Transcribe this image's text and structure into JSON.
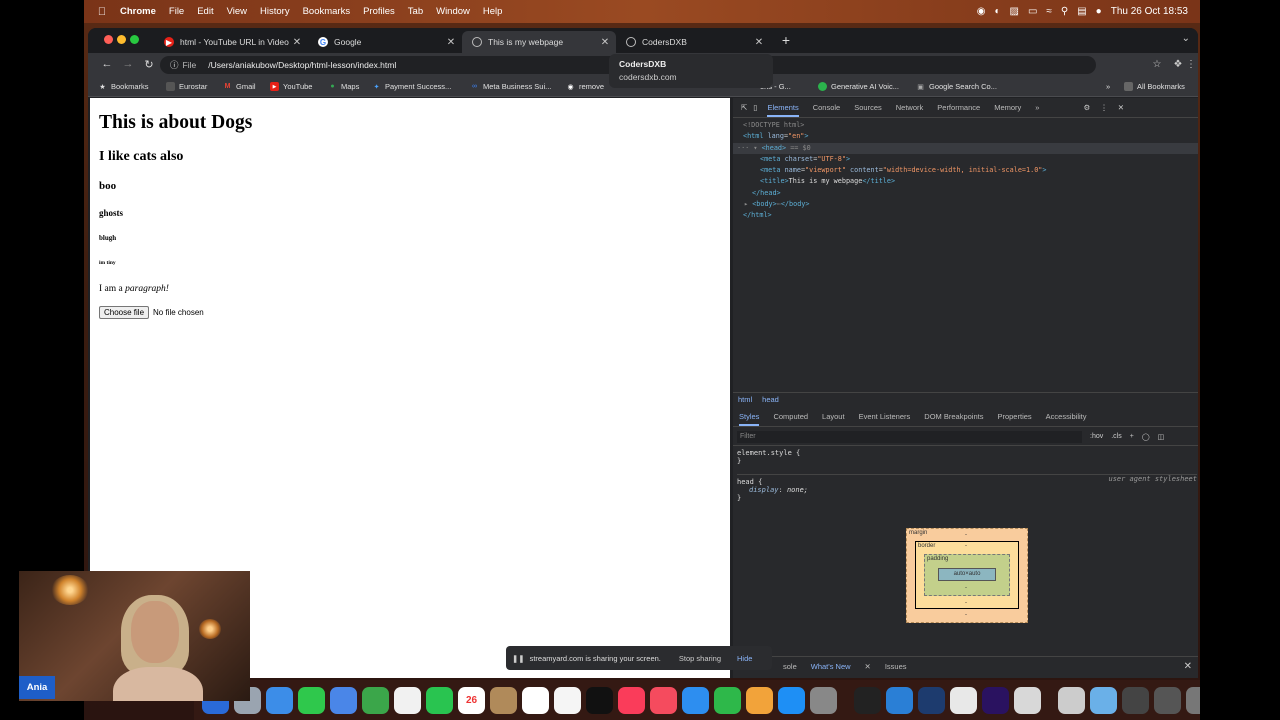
{
  "menubar": {
    "app": "Chrome",
    "items": [
      "File",
      "Edit",
      "View",
      "History",
      "Bookmarks",
      "Profiles",
      "Tab",
      "Window",
      "Help"
    ],
    "datetime": "Thu 26 Oct  18:53"
  },
  "tabs": [
    {
      "label": "html - YouTube URL in Video T",
      "icon": "youtube-icon",
      "active": false
    },
    {
      "label": "Google",
      "icon": "google-icon",
      "active": false
    },
    {
      "label": "This is my webpage",
      "icon": "globe-icon",
      "active": true
    },
    {
      "label": "CodersDXB",
      "icon": "globe-icon",
      "active": false
    }
  ],
  "tooltip": {
    "title": "CodersDXB",
    "subtitle": "codersdxb.com"
  },
  "omnibox": {
    "scheme": "File",
    "path": "/Users/aniakubow/Desktop/html-lesson/index.html"
  },
  "bookmarks": {
    "items": [
      "Bookmarks",
      "Eurostar",
      "Gmail",
      "YouTube",
      "Maps",
      "Payment Success...",
      "Meta Business Sui...",
      "remove"
    ],
    "right_items": [
      "ons - G...",
      "Generative AI Voic...",
      "Google Search Co..."
    ],
    "all": "All Bookmarks"
  },
  "page": {
    "h1": "This is about Dogs",
    "h2": "I like cats also",
    "h3": "boo",
    "h4": "ghosts",
    "h5": "blugh",
    "h6": "im tiny",
    "p_text": "I am a ",
    "p_em": "paragraph!",
    "file_button": "Choose file",
    "file_status": "No file chosen"
  },
  "devtools": {
    "tabs": [
      "Elements",
      "Console",
      "Sources",
      "Network",
      "Performance",
      "Memory"
    ],
    "active_tab": "Elements",
    "dom": {
      "doctype": "<!DOCTYPE html>",
      "html_open_tag": "<html",
      "html_attr_name": "lang",
      "html_attr_value": "\"en\"",
      "head_open": "<head>",
      "head_marker": "== $0",
      "meta1_tag": "<meta",
      "meta1_attr": "charset",
      "meta1_val": "\"UTF-8\"",
      "meta2_tag": "<meta",
      "meta2_attr1": "name",
      "meta2_val1": "\"viewport\"",
      "meta2_attr2": "content",
      "meta2_val2": "\"width=device-width, initial-scale=1.0\"",
      "title_open": "<title>",
      "title_text": "This is my webpage",
      "title_close": "</title>",
      "head_close": "</head>",
      "body_collapsed": "<body>",
      "body_ellipsis": "⋯",
      "body_close": "</body>",
      "html_close": "</html>"
    },
    "breadcrumb": [
      "html",
      "head"
    ],
    "style_tabs": [
      "Styles",
      "Computed",
      "Layout",
      "Event Listeners",
      "DOM Breakpoints",
      "Properties",
      "Accessibility"
    ],
    "filter_placeholder": "Filter",
    "filter_hov": ":hov",
    "filter_cls": ".cls",
    "rule1_selector": "element.style {",
    "rule1_close": "}",
    "rule2_selector": "head {",
    "rule2_prop": "display",
    "rule2_value": "none;",
    "rule2_source": "user agent stylesheet",
    "rule2_close": "}",
    "boxmodel": {
      "margin": "margin",
      "border": "border",
      "padding": "padding",
      "content": "auto×auto",
      "dash": "-"
    },
    "drawer_tabs": [
      "sole",
      "What's New",
      "Issues"
    ]
  },
  "sharebar": {
    "message": "streamyard.com is sharing your screen.",
    "stop": "Stop sharing",
    "hide": "Hide"
  },
  "dock_calendar_day": "26",
  "webcam_name": "Ania"
}
